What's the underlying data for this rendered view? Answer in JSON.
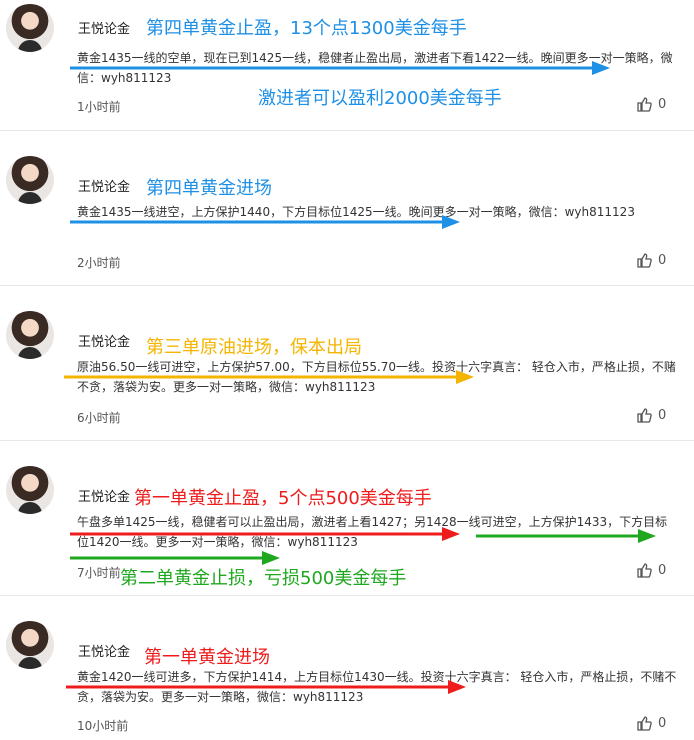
{
  "posts": [
    {
      "author": "王悦论金",
      "annotation": "第四单黄金止盈，13个点1300美金每手",
      "annotation2": "激进者可以盈利2000美金每手",
      "text": "黄金1435一线的空单，现在已到1425一线，稳健者止盈出局，激进者下看1422一线。晚间更多一对一策略，微信：wyh811123",
      "time": "1小时前",
      "likes": "0"
    },
    {
      "author": "王悦论金",
      "annotation": "第四单黄金进场",
      "text": "黄金1435一线进空，上方保护1440，下方目标位1425一线。晚间更多一对一策略，微信：wyh811123",
      "time": "2小时前",
      "likes": "0"
    },
    {
      "author": "王悦论金",
      "annotation": "第三单原油进场，保本出局",
      "text": "原油56.50一线可进空，上方保护57.00，下方目标位55.70一线。投资十六字真言： 轻仓入市，严格止损，不赌不贪，落袋为安。更多一对一策略，微信：wyh811123",
      "time": "6小时前",
      "likes": "0"
    },
    {
      "author": "王悦论金",
      "annotation": "第一单黄金止盈，5个点500美金每手",
      "annotation2": "第二单黄金止损，亏损500美金每手",
      "text": "午盘多单1425一线，稳健者可以止盈出局，激进者上看1427；另1428一线可进空，上方保护1433，下方目标位1420一线。更多一对一策略，微信：wyh811123",
      "time": "7小时前",
      "likes": "0"
    },
    {
      "author": "王悦论金",
      "annotation": "第一单黄金进场",
      "text": "黄金1420一线可进多，下方保护1414，上方目标位1430一线。投资十六字真言： 轻仓入市，严格止损，不赌不贪，落袋为安。更多一对一策略，微信：wyh811123",
      "time": "10小时前",
      "likes": "0"
    }
  ],
  "colors": {
    "blue": "#1e90e6",
    "orange": "#f5b400",
    "red": "#ee1c1c",
    "green": "#1fa81f"
  },
  "icons": {
    "like": "thumbs-up-icon"
  }
}
